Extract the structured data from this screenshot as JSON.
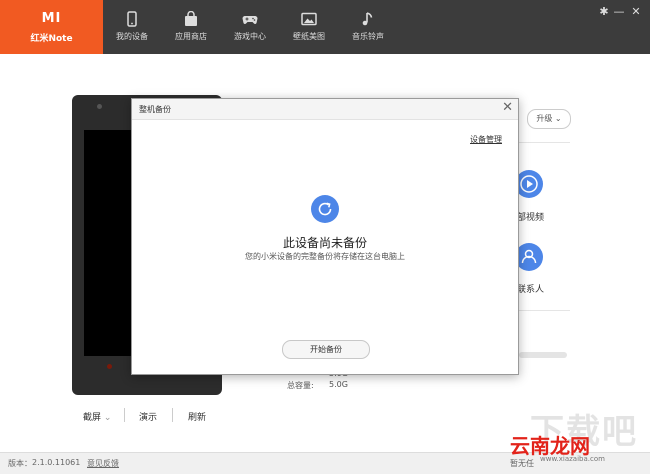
{
  "brand": {
    "logo": "MI",
    "name": "红米Note"
  },
  "nav": [
    {
      "label": "我的设备",
      "icon": "phone-icon"
    },
    {
      "label": "应用商店",
      "icon": "bag-icon"
    },
    {
      "label": "游戏中心",
      "icon": "gamepad-icon"
    },
    {
      "label": "壁纸美图",
      "icon": "picture-icon"
    },
    {
      "label": "音乐铃声",
      "icon": "music-note-icon"
    }
  ],
  "window_controls": {
    "settings": "✱",
    "minimize": "—",
    "close": "✕"
  },
  "device": {
    "actions": {
      "screenshot": "截屏",
      "present": "演示",
      "refresh": "刷新"
    },
    "upgrade": "升级",
    "features": {
      "video": "部视频",
      "contacts": "联系人"
    },
    "storage": {
      "value1": "5.0G",
      "total_label": "总容量:",
      "total": "5.0G"
    }
  },
  "status_bar": {
    "version_label": "版本：",
    "version": "2.1.0.11061",
    "feedback": "意见反馈",
    "status": "暂无任"
  },
  "dialog": {
    "title": "整机备份",
    "close": "✕",
    "manage": "设备管理",
    "heading": "此设备尚未备份",
    "subtitle": "您的小米设备的完整备份将存储在这台电脑上",
    "start": "开始备份"
  },
  "watermark": {
    "big": "下载吧",
    "red": "云南龙网",
    "url": "www.xiazaiba.com"
  },
  "colors": {
    "brand": "#f15a22",
    "topbar": "#3c3c3c",
    "accent": "#4d86e8"
  }
}
